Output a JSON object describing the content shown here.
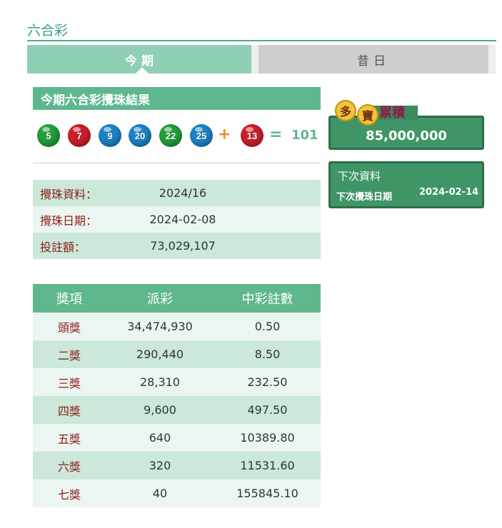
{
  "section_title": "六合彩",
  "tabs": {
    "today": "今期",
    "past": "昔日"
  },
  "result": {
    "heading": "今期六合彩攪珠結果",
    "balls": [
      {
        "number": "5",
        "color": "#1f9e3b"
      },
      {
        "number": "7",
        "color": "#c8202b"
      },
      {
        "number": "9",
        "color": "#1d82c3"
      },
      {
        "number": "20",
        "color": "#1d82c3"
      },
      {
        "number": "22",
        "color": "#1f9e3b"
      },
      {
        "number": "25",
        "color": "#1d82c3"
      }
    ],
    "plus": "+",
    "special": {
      "number": "13",
      "color": "#c8202b"
    },
    "equals": "=",
    "sum": "101"
  },
  "info": [
    {
      "label": "攪珠資料：",
      "value": "2024/16"
    },
    {
      "label": "攪珠日期：",
      "value": "2024-02-08"
    },
    {
      "label": "投註額：",
      "value": "73,029,107"
    }
  ],
  "prize_table": {
    "headers": [
      "獎項",
      "派彩",
      "中彩註數"
    ],
    "rows": [
      [
        "頭獎",
        "34,474,930",
        "0.50"
      ],
      [
        "二獎",
        "290,440",
        "8.50"
      ],
      [
        "三獎",
        "28,310",
        "232.50"
      ],
      [
        "四獎",
        "9,600",
        "497.50"
      ],
      [
        "五獎",
        "640",
        "10389.80"
      ],
      [
        "六獎",
        "320",
        "11531.60"
      ],
      [
        "七獎",
        "40",
        "155845.10"
      ]
    ]
  },
  "jackpot": {
    "badge_chars": [
      "多",
      "寶"
    ],
    "badge_label": "累積",
    "amount": "85,000,000"
  },
  "next_draw": {
    "title": "下次資料",
    "date_label": "下次攪珠日期",
    "date": "2024-02-14"
  }
}
